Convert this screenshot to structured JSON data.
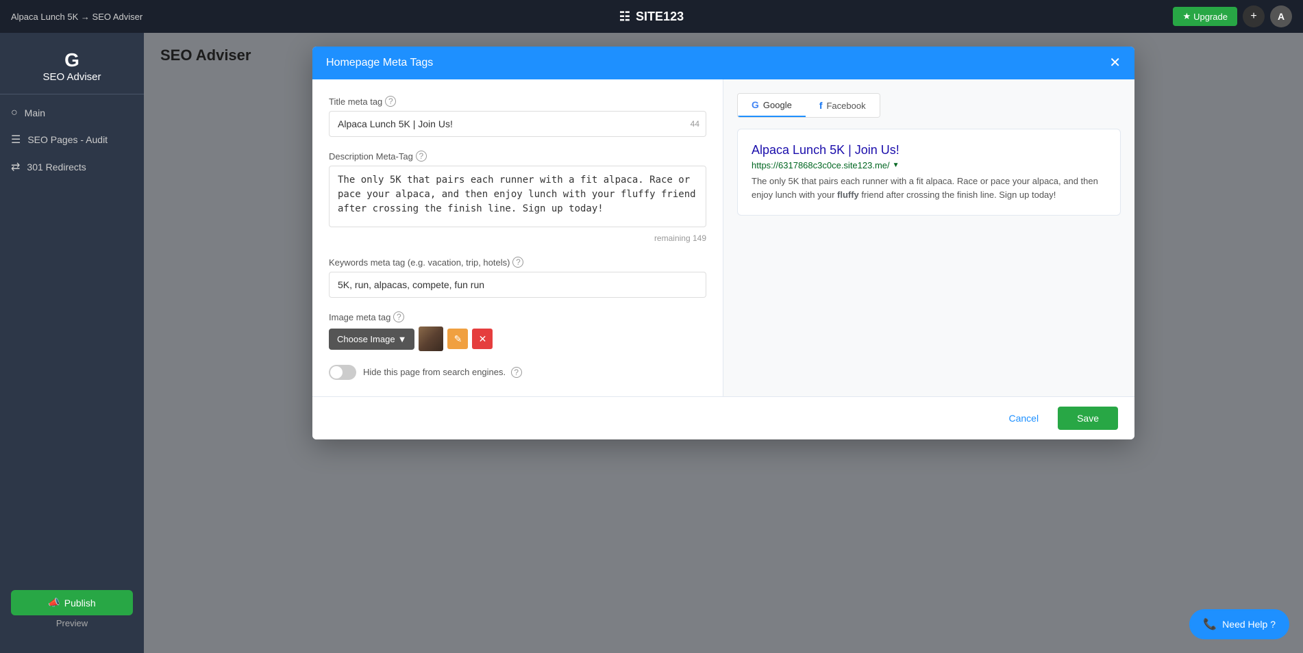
{
  "topbar": {
    "breadcrumb": "Alpaca Lunch 5K → SEO Adviser",
    "site_name": "SITE123",
    "upgrade_label": "Upgrade",
    "add_icon": "+",
    "avatar_letter": "A"
  },
  "sidebar": {
    "logo_letter": "G",
    "logo_text": "SEO Adviser",
    "items": [
      {
        "id": "main",
        "label": "Main",
        "icon": "○"
      },
      {
        "id": "seo-pages-audit",
        "label": "SEO Pages - Audit",
        "icon": "≡"
      },
      {
        "id": "redirects",
        "label": "301 Redirects",
        "icon": "⇌"
      }
    ],
    "publish_label": "Publish",
    "preview_label": "Preview"
  },
  "main": {
    "heading": "SEO Adviser"
  },
  "modal": {
    "title": "Homepage Meta Tags",
    "close_icon": "✕",
    "left": {
      "title_meta_tag": {
        "label": "Title meta tag",
        "value": "Alpaca Lunch 5K | Join Us!",
        "char_count": "44"
      },
      "description_meta_tag": {
        "label": "Description Meta-Tag",
        "value": "The only 5K that pairs each runner with a fit alpaca. Race or pace your alpaca, and then enjoy lunch with your fluffy friend after crossing the finish line. Sign up today!",
        "remaining": "remaining 149"
      },
      "keywords_meta_tag": {
        "label": "Keywords meta tag (e.g. vacation, trip, hotels)",
        "value": "5K, run, alpacas, compete, fun run"
      },
      "image_meta_tag": {
        "label": "Image meta tag",
        "choose_image_label": "Choose Image",
        "chevron": "▾"
      },
      "hide_label": "Hide this page from search engines."
    },
    "right": {
      "tabs": [
        {
          "id": "google",
          "label": "Google",
          "icon": "G",
          "active": true
        },
        {
          "id": "facebook",
          "label": "Facebook",
          "icon": "f",
          "active": false
        }
      ],
      "google_preview": {
        "title": "Alpaca Lunch 5K | Join Us!",
        "url": "https://6317868c3c0ce.site123.me/",
        "description": "The only 5K that pairs each runner with a fit alpaca. Race or pace your alpaca, and then enjoy lunch with your fluffy friend after crossing the finish line. Sign up today!"
      }
    },
    "footer": {
      "cancel_label": "Cancel",
      "save_label": "Save"
    }
  },
  "need_help": {
    "label": "Need Help ?"
  }
}
